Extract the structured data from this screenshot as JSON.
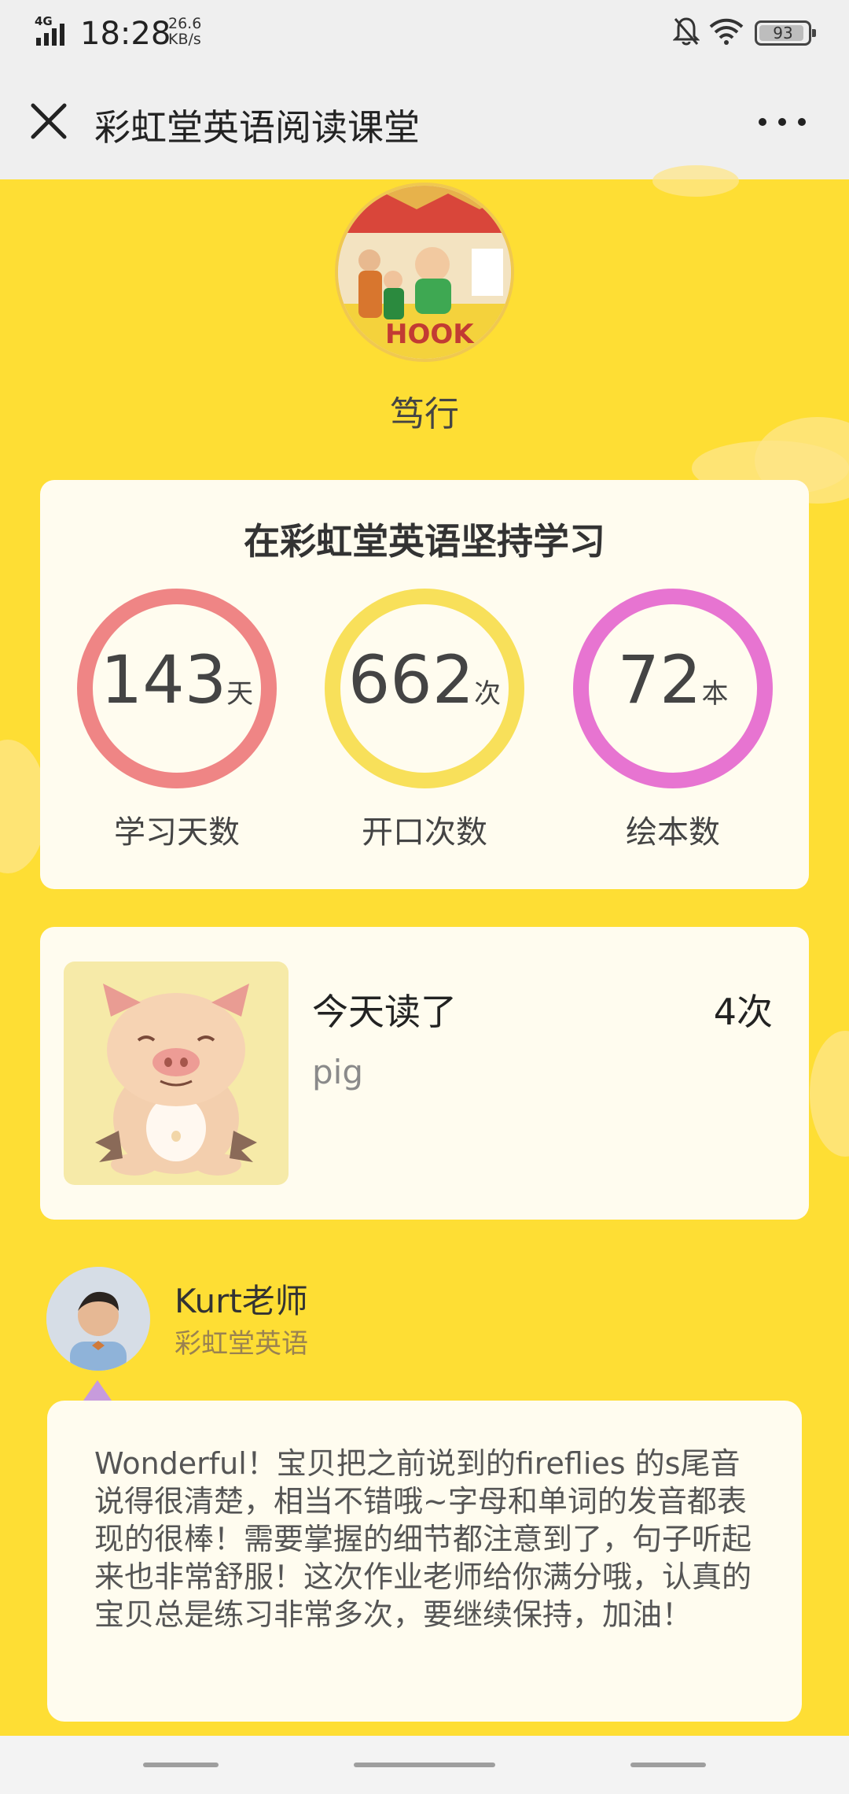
{
  "status_bar": {
    "network": "4G",
    "time": "18:28",
    "speed_value": "26.6",
    "speed_unit": "KB/s",
    "battery": "93"
  },
  "nav": {
    "title": "彩虹堂英语阅读课堂",
    "close_icon": "close-icon",
    "more_icon": "more-dots-icon"
  },
  "profile": {
    "name": "笃行"
  },
  "stats": {
    "title": "在彩虹堂英语坚持学习",
    "items": [
      {
        "value": "143",
        "unit": "天",
        "label": "学习天数",
        "color": "#ef8585"
      },
      {
        "value": "662",
        "unit": "次",
        "label": "开口次数",
        "color": "#f8e05a"
      },
      {
        "value": "72",
        "unit": "本",
        "label": "绘本数",
        "color": "#e774d1"
      }
    ]
  },
  "reading": {
    "title": "今天读了",
    "count": "4次",
    "book": "pig"
  },
  "teacher": {
    "name": "Kurt老师",
    "org": "彩虹堂英语",
    "comment": "Wonderful！宝贝把之前说到的fireflies 的s尾音说得很清楚，相当不错哦~字母和单词的发音都表现的很棒！需要掌握的细节都注意到了，句子听起来也非常舒服！这次作业老师给你满分哦，认真的宝贝总是练习非常多次，要继续保持，加油！"
  },
  "colors": {
    "background": "#fede34",
    "card": "#fffcef"
  }
}
